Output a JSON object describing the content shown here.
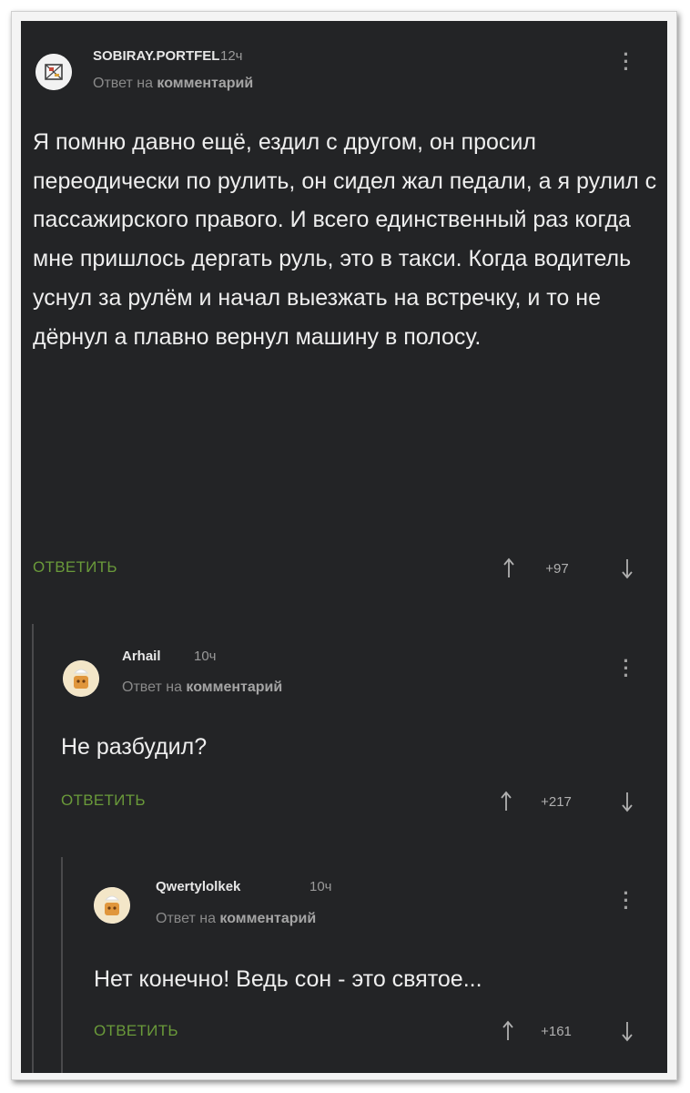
{
  "comments": [
    {
      "author": "SOBIRAY.PORTFEL",
      "time": "12ч",
      "reply_prefix": "Ответ на",
      "reply_target": "комментарий",
      "text": "Я помню давно ещё, ездил с другом, он просил переодически по рулить, он сидел жал педали, а я рулил с пассажирского правого. И всего единственный раз когда мне пришлось дергать руль, это в такси. Когда водитель уснул за рулём и начал выезжать на встречку, и то не дёрнул а плавно вернул машину в полосу.",
      "reply_label": "ОТВЕТИТЬ",
      "score": "+97"
    },
    {
      "author": "Arhail",
      "time": "10ч",
      "reply_prefix": "Ответ на",
      "reply_target": "комментарий",
      "text": "Не разбудил?",
      "reply_label": "ОТВЕТИТЬ",
      "score": "+217"
    },
    {
      "author": "Qwertylolkek",
      "time": "10ч",
      "reply_prefix": "Ответ на",
      "reply_target": "комментарий",
      "text": "Нет конечно! Ведь сон - это святое...",
      "reply_label": "ОТВЕТИТЬ",
      "score": "+161"
    }
  ],
  "icons": {
    "menu": "vertical-dots-icon",
    "upvote": "arrow-up-icon",
    "downvote": "arrow-down-icon"
  },
  "colors": {
    "background": "#232426",
    "reply_button": "#6a9a3a",
    "text": "#eeeeee",
    "meta": "#8a8a8a"
  }
}
